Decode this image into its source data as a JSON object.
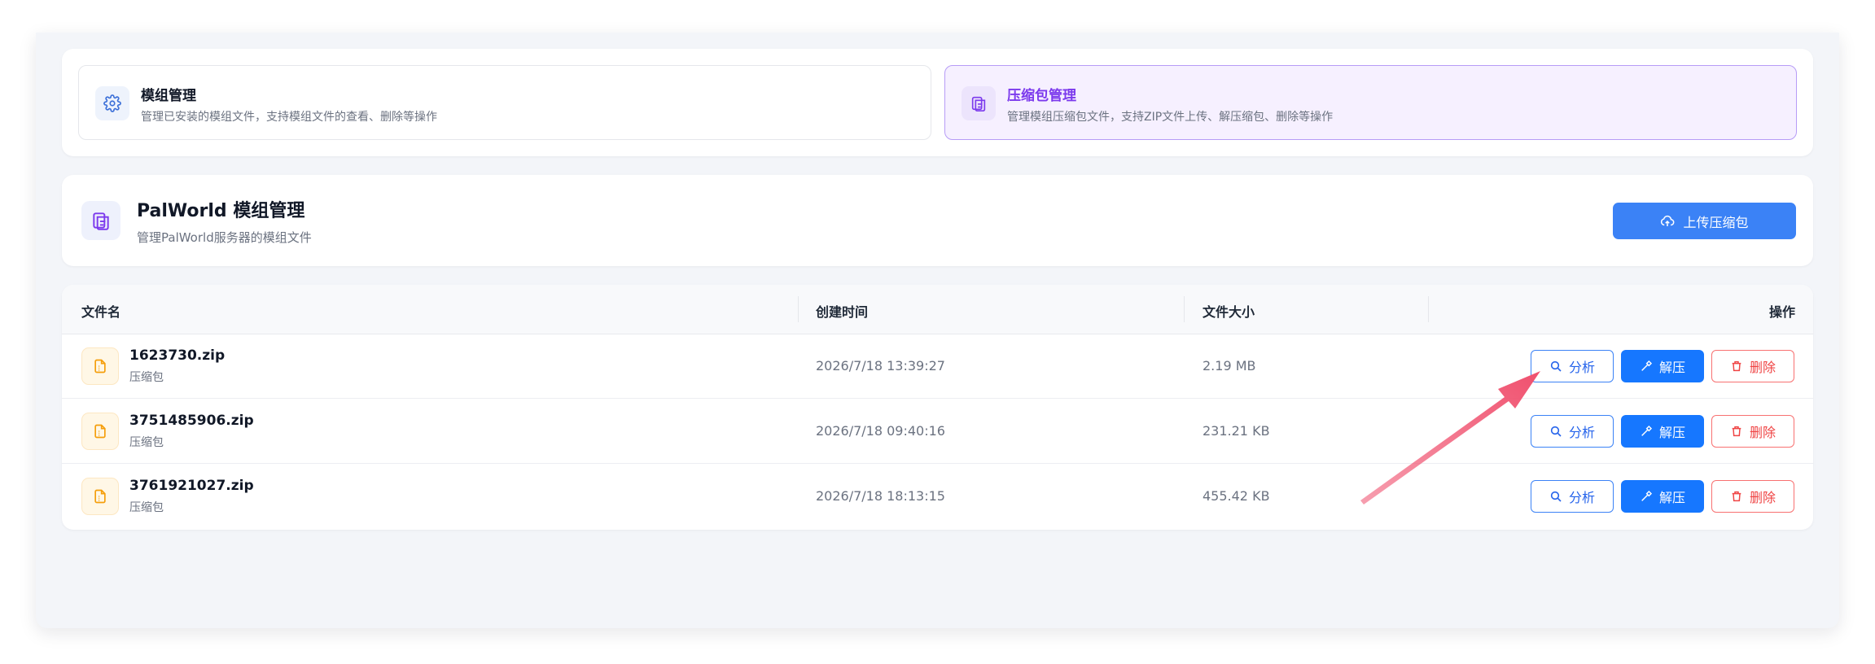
{
  "tabs": [
    {
      "title": "模组管理",
      "desc": "管理已安装的模组文件，支持模组文件的查看、删除等操作",
      "icon": "gear-icon",
      "active": false
    },
    {
      "title": "压缩包管理",
      "desc": "管理模组压缩包文件，支持ZIP文件上传、解压缩包、删除等操作",
      "icon": "clipboard-files-icon",
      "active": true
    }
  ],
  "header": {
    "title": "PalWorld 模组管理",
    "subtitle": "管理PalWorld服务器的模组文件",
    "upload_label": "上传压缩包"
  },
  "table": {
    "columns": {
      "name": "文件名",
      "created": "创建时间",
      "size": "文件大小",
      "actions": "操作"
    },
    "rows": [
      {
        "name": "1623730.zip",
        "type": "压缩包",
        "created": "2026/7/18 13:39:27",
        "size": "2.19 MB"
      },
      {
        "name": "3751485906.zip",
        "type": "压缩包",
        "created": "2026/7/18 09:40:16",
        "size": "231.21 KB"
      },
      {
        "name": "3761921027.zip",
        "type": "压缩包",
        "created": "2026/7/18 18:13:15",
        "size": "455.42 KB"
      }
    ],
    "actions": {
      "analyze": "分析",
      "extract": "解压",
      "delete": "删除"
    }
  },
  "colors": {
    "primary": "#1677ff",
    "accent_purple": "#7c3aed",
    "danger": "#ef4444",
    "file_icon": "#f59e0b",
    "annotation_arrow": "#f0506e"
  }
}
